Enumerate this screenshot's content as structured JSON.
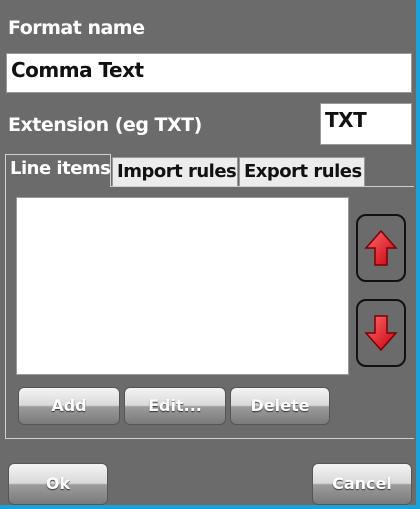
{
  "form": {
    "format_name_label": "Format name",
    "format_name_value": "Comma Text",
    "extension_label": "Extension (eg TXT)",
    "extension_value": "TXT"
  },
  "tabs": [
    {
      "label": "Line items",
      "active": true
    },
    {
      "label": "Import rules",
      "active": false
    },
    {
      "label": "Export rules",
      "active": false
    }
  ],
  "list": {
    "items": [],
    "move_up_icon": "arrow-up-icon",
    "move_down_icon": "arrow-down-icon"
  },
  "list_actions": {
    "add_label": "Add",
    "edit_label": "Edit...",
    "delete_label": "Delete"
  },
  "footer": {
    "ok_label": "Ok",
    "cancel_label": "Cancel"
  },
  "colors": {
    "background": "#6b6b6b",
    "accent_border": "#1aa3d9",
    "arrow_red": "#e8001c"
  }
}
